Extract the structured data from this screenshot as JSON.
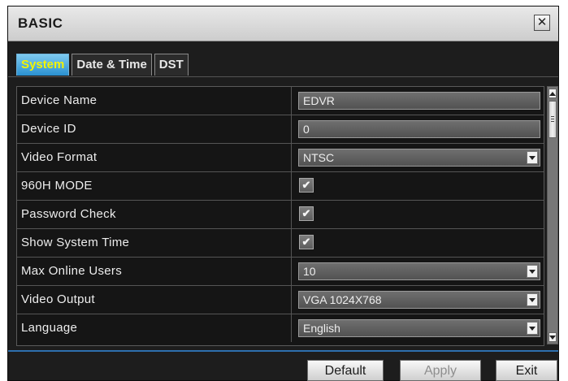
{
  "window": {
    "title": "BASIC",
    "close_glyph": "✕"
  },
  "tabs": [
    {
      "label": "System",
      "active": true
    },
    {
      "label": "Date & Time",
      "active": false
    },
    {
      "label": "DST",
      "active": false
    }
  ],
  "rows": {
    "device_name": {
      "label": "Device Name",
      "value": "EDVR"
    },
    "device_id": {
      "label": "Device ID",
      "value": "0"
    },
    "video_format": {
      "label": "Video Format",
      "value": "NTSC"
    },
    "mode_960h": {
      "label": "960H MODE",
      "checked": true
    },
    "password_check": {
      "label": "Password Check",
      "checked": true
    },
    "show_system_time": {
      "label": "Show System Time",
      "checked": true
    },
    "max_online_users": {
      "label": "Max Online Users",
      "value": "10"
    },
    "video_output": {
      "label": "Video Output",
      "value": "VGA 1024X768"
    },
    "language": {
      "label": "Language",
      "value": "English"
    }
  },
  "checkmark": "✔",
  "buttons": {
    "default": "Default",
    "apply": "Apply",
    "exit": "Exit"
  },
  "colors": {
    "active_tab_text": "#f4f400",
    "active_tab_bg": "#3aa0dc",
    "accent_rule": "#2d6fae"
  }
}
